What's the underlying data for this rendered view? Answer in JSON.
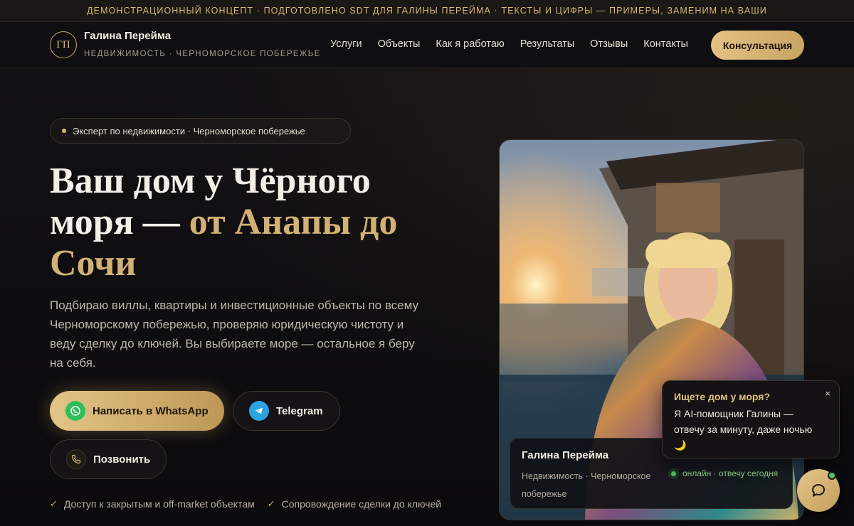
{
  "topbar": {
    "text": "ДЕМОНСТРАЦИОННЫЙ КОНЦЕПТ · ПОДГОТОВЛЕНО SDT ДЛЯ ГАЛИНЫ ПЕРЕЙМА · ТЕКСТЫ И ЦИФРЫ — ПРИМЕРЫ, ЗАМЕНИМ НА ВАШИ"
  },
  "header": {
    "logo_initials": "ГП",
    "brand_name": "Галина Перейма",
    "brand_sub": "НЕДВИЖИМОСТЬ · ЧЕРНОМОРСКОЕ ПОБЕРЕЖЬЕ",
    "nav": [
      "Услуги",
      "Объекты",
      "Как я работаю",
      "Результаты",
      "Отзывы",
      "Контакты"
    ],
    "cta_label": "Консультация"
  },
  "hero": {
    "pill": "Эксперт по недвижимости · Черноморское побережье",
    "headline_part1": "Ваш дом у Чёрного моря — ",
    "headline_gold": "от Анапы до Сочи",
    "lead": "Подбираю виллы, квартиры и инвестиционные объекты по всему Черноморскому побережью, проверяю юридическую чистоту и веду сделку до ключей. Вы выбираете море — остальное я беру на себя.",
    "btn_whatsapp": "Написать в WhatsApp",
    "btn_telegram": "Telegram",
    "btn_call": "Позвонить",
    "checks": [
      "Доступ к закрытым и off-market объектам",
      "Сопровождение сделки до ключей"
    ]
  },
  "profile_card": {
    "name": "Галина Перейма",
    "sub": "Недвижимость · Черноморское побережье",
    "status": "онлайн · отвечу сегодня"
  },
  "chat": {
    "title": "Ищете дом у моря?",
    "text": "Я AI-помощник Галины — отвечу за минуту, даже ночью 🌙",
    "close": "×"
  },
  "colors": {
    "gold": "#d3b074",
    "background": "#0c0b0d",
    "online": "#4fc25a"
  },
  "icons": {
    "whatsapp": "whatsapp-icon",
    "telegram": "telegram-icon",
    "phone": "phone-icon",
    "check": "check-icon",
    "chat": "chat-bubble-icon"
  }
}
